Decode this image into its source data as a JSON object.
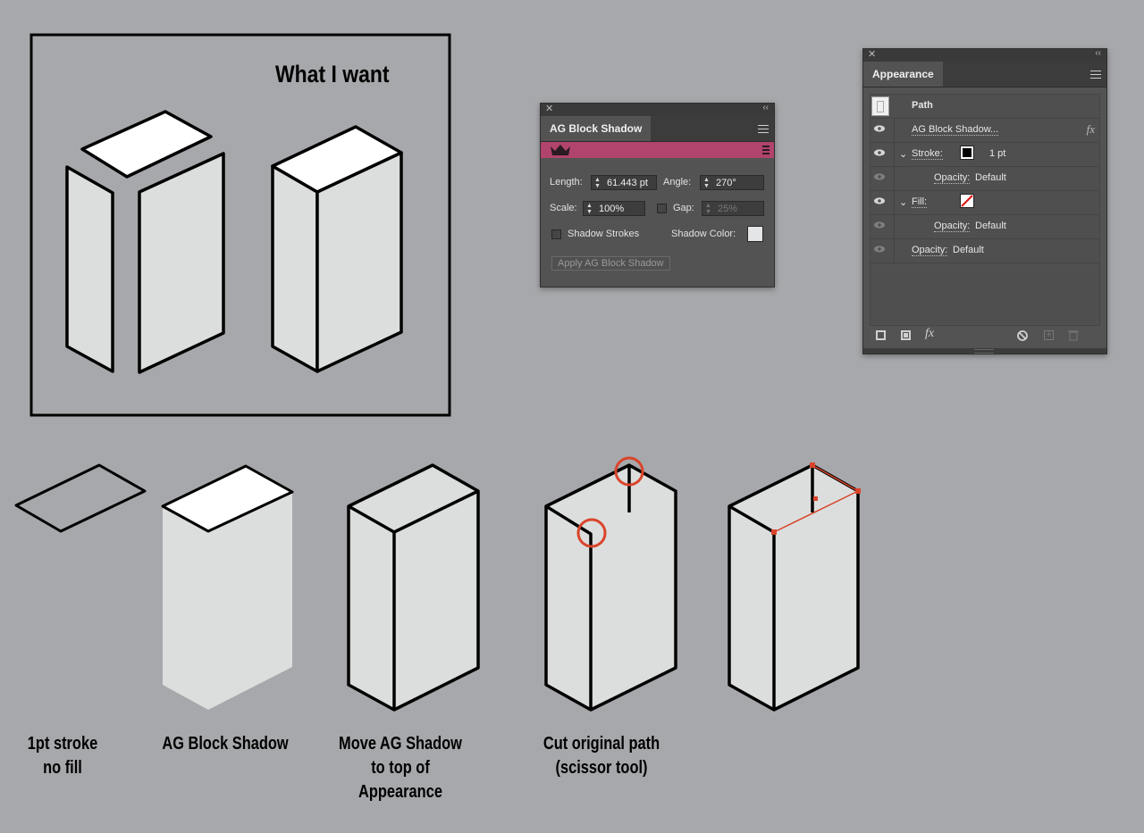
{
  "illustration": {
    "title": "What I want",
    "captions": [
      {
        "lines": [
          "1pt stroke",
          "no fill"
        ]
      },
      {
        "lines": [
          "AG Block Shadow"
        ]
      },
      {
        "lines": [
          "Move AG Shadow",
          "to top of",
          "Appearance"
        ]
      },
      {
        "lines": [
          "Cut original path",
          "(scissor tool)"
        ]
      }
    ]
  },
  "ag_panel": {
    "tab": "AG Block Shadow",
    "length_label": "Length:",
    "length_value": "61.443 pt",
    "angle_label": "Angle:",
    "angle_value": "270°",
    "scale_label": "Scale:",
    "scale_value": "100%",
    "gap_label": "Gap:",
    "gap_value": "25%",
    "shadow_strokes_label": "Shadow Strokes",
    "shadow_color_label": "Shadow Color:",
    "apply_label": "Apply AG Block Shadow",
    "banner_color": "#b0446d"
  },
  "appearance_panel": {
    "tab": "Appearance",
    "path_label": "Path",
    "effect_label": "AG Block Shadow...",
    "fx_label": "fx",
    "stroke_label": "Stroke:",
    "stroke_weight": "1 pt",
    "stroke_opacity_label": "Opacity:",
    "stroke_opacity_value": "Default",
    "fill_label": "Fill:",
    "fill_opacity_label": "Opacity:",
    "fill_opacity_value": "Default",
    "opacity_label": "Opacity:",
    "opacity_value": "Default",
    "footer_fx": "fx"
  },
  "colors": {
    "background": "#a7a8ab",
    "face_fill": "#dcdedd",
    "highlight": "#d9452b"
  }
}
